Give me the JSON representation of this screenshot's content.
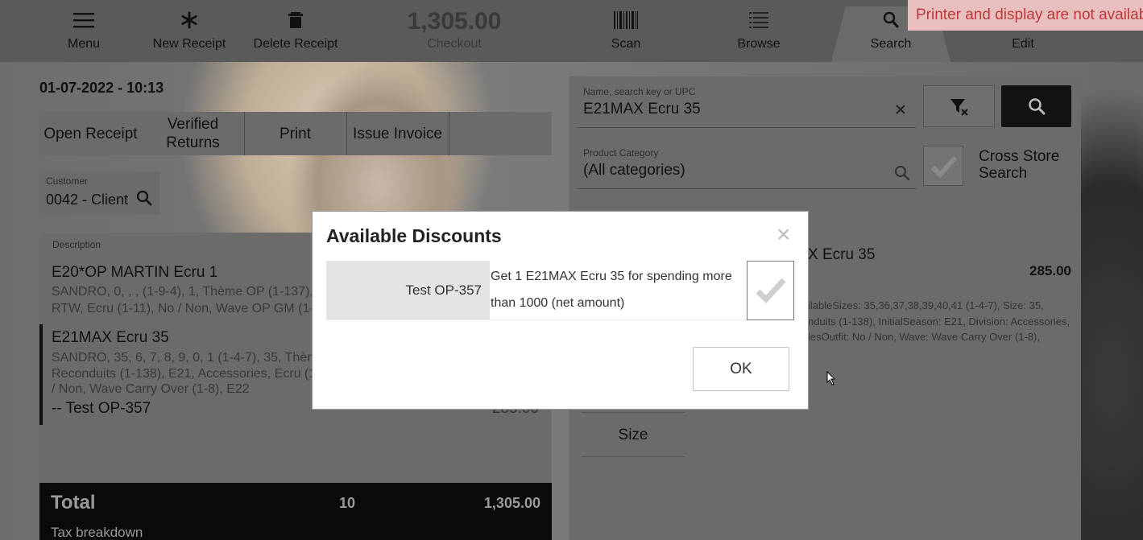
{
  "toolbar": {
    "menu_label": "Menu",
    "new_receipt_label": "New Receipt",
    "delete_receipt_label": "Delete Receipt",
    "checkout_amount": "1,305.00",
    "checkout_label": "Checkout",
    "scan_label": "Scan",
    "browse_label": "Browse",
    "search_label": "Search",
    "edit_label": "Edit",
    "icons": [
      "menu-icon",
      "asterisk-icon",
      "trash-icon",
      "barcode-icon",
      "list-icon",
      "search-icon"
    ]
  },
  "toast": {
    "message": "Printer and display are not available.",
    "background": "#e9bebe",
    "text_color": "#c0383a"
  },
  "ticket": {
    "datetime": "01-07-2022 - 10:13",
    "actions": {
      "open_receipt": "Open Receipt",
      "verified_returns": "Verified Returns",
      "print": "Print",
      "issue_invoice": "Issue Invoice"
    },
    "customer": {
      "caption": "Customer",
      "value": "0042 - Client"
    },
    "description_header": "Description",
    "lines": [
      {
        "name": "E20*OP MARTIN Ecru 1",
        "props": "SANDRO, 0, , , (1-9-4), 1, Thème OP (1-137), E",
        "props2": "RTW, Ecru (1-11), No / Non, Wave OP GM (1-7)"
      },
      {
        "name": "E21MAX Ecru 35",
        "props": "SANDRO, 35, 6, 7, 8, 9, 0, 1 (1-4-7), 35, Thème",
        "props2": "Reconduits (1-138), E21, Accessories, Ecru (1-",
        "props3": "/ Non, Wave Carry Over (1-8), E22",
        "discount": "-- Test OP-357",
        "discount_amount": "-285.00"
      }
    ],
    "total": {
      "label": "Total",
      "quantity": "10",
      "amount": "1,305.00",
      "tax_breakdown": "Tax breakdown"
    }
  },
  "search": {
    "name_field": {
      "caption": "Name, search key or UPC",
      "value": "E21MAX Ecru 35"
    },
    "category_field": {
      "caption": "Product Category",
      "value": "(All categories)"
    },
    "cross_store_label": "Cross Store Search",
    "result": {
      "name_partial": "X Ecru 35",
      "price": "285.00",
      "props_line1": "ilableSizes: 35,36,37,38,39,40,41 (1-4-7), Size: 35,",
      "props_line2": "nduits (1-138), InitialSeason: E21, Division: Accessories,",
      "props_line3": "lesOutfit: No / Non, Wave: Wave Carry Over (1-8),"
    },
    "size_button": "Size"
  },
  "modal": {
    "title": "Available Discounts",
    "discount": {
      "name": "Test OP-357",
      "description": "Get 1 E21MAX Ecru 35 for spending more than 1000 (net amount)"
    },
    "ok_label": "OK"
  }
}
